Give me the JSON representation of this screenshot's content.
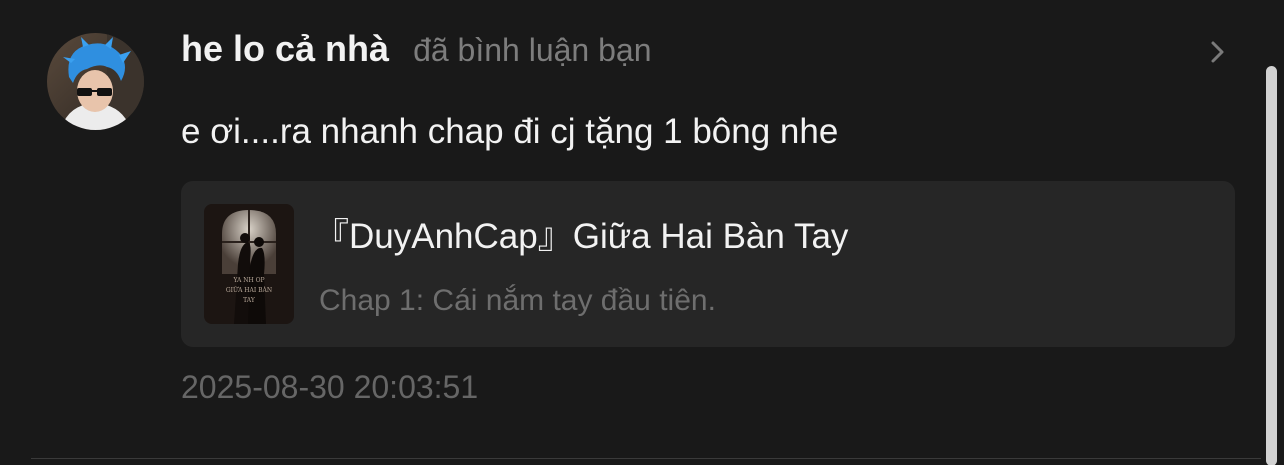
{
  "notification": {
    "username": "he lo cả nhà",
    "action": "đã bình luận bạn",
    "comment": "e ơi....ra nhanh chap đi cj tặng 1 bông nhe",
    "story": {
      "title": "『DuyAnhCap』Giữa Hai Bàn Tay",
      "chapter": "Chap 1: Cái nắm tay đầu tiên.",
      "cover_text_lines": [
        "YA NH OP",
        "GIỮA HAI BÀN",
        "TAY"
      ]
    },
    "timestamp": "2025-08-30 20:03:51"
  },
  "icons": {
    "chevron": "chevron-right-icon"
  },
  "colors": {
    "background": "#191919",
    "card_background": "#262626",
    "primary_text": "#f2f2f2",
    "secondary_text": "#7d7d7d",
    "avatar_hair": "#2f8fe0"
  }
}
